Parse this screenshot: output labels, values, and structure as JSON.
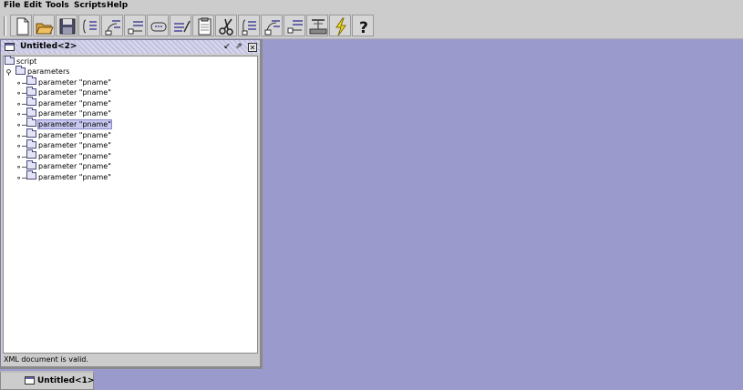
{
  "menubar": {
    "items": [
      "File",
      "Edit",
      "Tools",
      "Scripts",
      "Help"
    ]
  },
  "toolbar": {
    "buttons": [
      {
        "icon": "new-document-icon"
      },
      {
        "icon": "open-folder-icon"
      },
      {
        "icon": "save-disk-icon"
      },
      {
        "icon": "insert-element-icon"
      },
      {
        "icon": "insert-child-element-icon"
      },
      {
        "icon": "insert-sibling-element-icon"
      },
      {
        "icon": "insert-loop-icon"
      },
      {
        "icon": "edit-element-icon"
      },
      {
        "icon": "clipboard-icon"
      },
      {
        "icon": "scissors-icon"
      },
      {
        "icon": "move-up-icon"
      },
      {
        "icon": "move-left-icon"
      },
      {
        "icon": "move-down-icon"
      },
      {
        "icon": "network-icon"
      },
      {
        "icon": "lightning-run-icon"
      },
      {
        "icon": "help-question-icon"
      }
    ]
  },
  "frame": {
    "title": "Untitled<2>",
    "tree": {
      "root": "script",
      "parent": "parameters",
      "children": [
        "parameter  \"pname\"",
        "parameter  \"pname\"",
        "parameter  \"pname\"",
        "parameter  \"pname\"",
        "parameter  \"pname\"",
        "parameter  \"pname\"",
        "parameter  \"pname\"",
        "parameter  \"pname\"",
        "parameter  \"pname\"",
        "parameter  \"pname\""
      ],
      "selected_index": 4
    },
    "status": "XML document is valid."
  },
  "taskbar": {
    "minimized_title": "Untitled<1>"
  },
  "colors": {
    "desktop": "#9a9acc",
    "chrome": "#cccccc",
    "selection": "#c8c8f0"
  }
}
